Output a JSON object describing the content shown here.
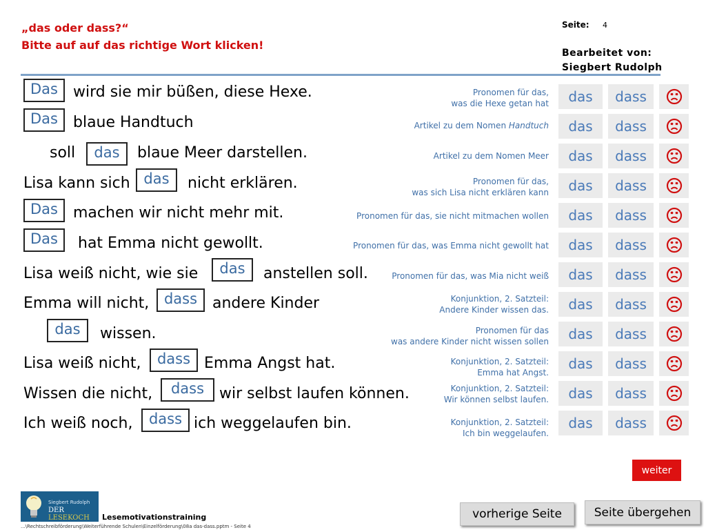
{
  "header": {
    "title": "„das oder dass?“",
    "subtitle": "Bitte auf auf das richtige Wort klicken!",
    "page_label": "Seite:",
    "page_number": "4",
    "editor_line1": "Bearbeitet von:",
    "editor_line2": "Siegbert Rudolph"
  },
  "rows": [
    {
      "pre": "",
      "answer": "Das",
      "post": "wird sie mir büßen, diese Hexe.",
      "hint1": "Pronomen für das,",
      "hint2": "was die Hexe getan hat",
      "opt_das": "das",
      "opt_dass": "dass"
    },
    {
      "pre": "",
      "answer": "Das",
      "post": "blaue Handtuch",
      "hint1": "Artikel zu dem Nomen Handtuch",
      "hint2": "",
      "opt_das": "das",
      "opt_dass": "dass"
    },
    {
      "pre": "soll",
      "answer": "das",
      "post": "blaue Meer darstellen.",
      "hint1": "Artikel zu dem Nomen Meer",
      "hint2": "",
      "opt_das": "das",
      "opt_dass": "dass"
    },
    {
      "pre": "Lisa kann sich",
      "answer": "das",
      "post": "nicht erklären.",
      "hint1": "Pronomen für das,",
      "hint2": "was sich Lisa nicht erklären kann",
      "opt_das": "das",
      "opt_dass": "dass"
    },
    {
      "pre": "",
      "answer": "Das",
      "post": "machen wir nicht mehr mit.",
      "hint1": "Pronomen für das, sie nicht mitmachen wollen",
      "hint2": "",
      "opt_das": "das",
      "opt_dass": "dass"
    },
    {
      "pre": "",
      "answer": "Das",
      "post": "hat Emma nicht gewollt.",
      "hint1": "Pronomen für das, was Emma nicht gewollt hat",
      "hint2": "",
      "opt_das": "das",
      "opt_dass": "dass"
    },
    {
      "pre": "Lisa weiß nicht, wie sie",
      "answer": "das",
      "post": "anstellen soll.",
      "hint1": "Pronomen für das, was Mia nicht weiß",
      "hint2": "",
      "opt_das": "das",
      "opt_dass": "dass"
    },
    {
      "pre": "Emma will nicht,",
      "answer": "dass",
      "post": "andere Kinder",
      "hint1": "Konjunktion, 2. Satzteil:",
      "hint2": "Andere Kinder wissen das.",
      "opt_das": "das",
      "opt_dass": "dass"
    },
    {
      "pre": "",
      "answer": "das",
      "post": "wissen.",
      "hint1": "Pronomen für das",
      "hint2": "was andere Kinder nicht wissen sollen",
      "opt_das": "das",
      "opt_dass": "dass"
    },
    {
      "pre": "Lisa weiß nicht,",
      "answer": "dass",
      "post": "Emma Angst hat.",
      "hint1": "Konjunktion, 2. Satzteil:",
      "hint2": "Emma hat Angst.",
      "opt_das": "das",
      "opt_dass": "dass"
    },
    {
      "pre": "Wissen die nicht,",
      "answer": "dass",
      "post": "wir selbst laufen können.",
      "hint1": "Konjunktion, 2. Satzteil:",
      "hint2": "Wir können selbst laufen.",
      "opt_das": "das",
      "opt_dass": "dass"
    },
    {
      "pre": "Ich weiß noch,",
      "answer": "dass",
      "post": "ich weggelaufen bin.",
      "hint1": "Konjunktion, 2. Satzteil:",
      "hint2": "Ich bin weggelaufen.",
      "opt_das": "das",
      "opt_dass": "dass"
    }
  ],
  "hint_italic_word": "Handtuch",
  "buttons": {
    "weiter": "weiter",
    "prev": "vorherige Seite",
    "skip": "Seite übergehen"
  },
  "footer": {
    "logo_line1": "Siegbert Rudolph",
    "logo_line2a": "DER ",
    "logo_line2b": "LESEKOCH",
    "title": "Lesemotivationstraining",
    "path": "...\\Rechtschreibförderung\\Weiterführende Schulen\\Einzelförderung\\08a das-dass.pptm - Seite 4"
  },
  "icons": {
    "sad": "sad-face-icon",
    "logo_bulb": "lightbulb-icon"
  },
  "colors": {
    "title_red": "#d01010",
    "hint_blue": "#4070a8",
    "option_blue": "#4a7ab8",
    "weiter_red": "#dd1111"
  }
}
